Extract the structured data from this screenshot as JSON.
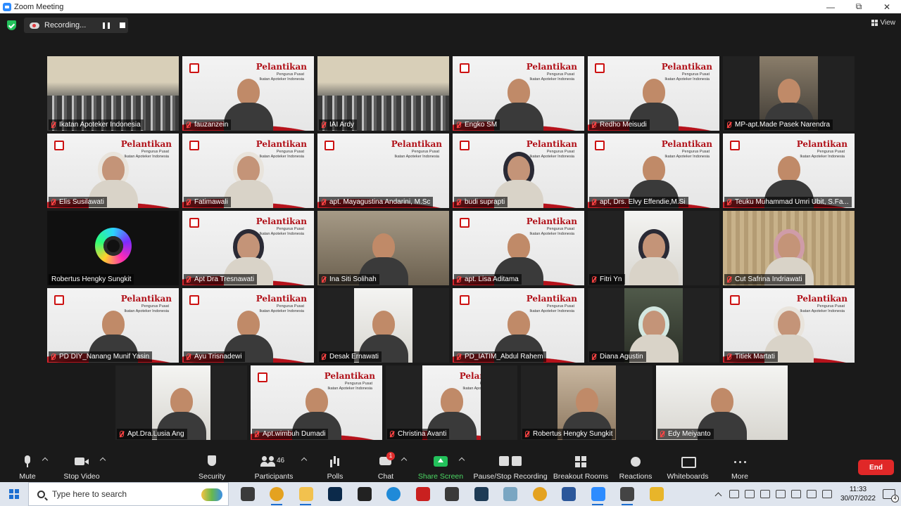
{
  "window": {
    "title": "Zoom Meeting"
  },
  "recording": {
    "label": "Recording..."
  },
  "view": {
    "label": "View"
  },
  "banner": {
    "title": "Pelantikan",
    "subtitle": "Pengurus Pusat\nIkatan Apoteker Indonesia"
  },
  "tiles": [
    {
      "name": "Ikatan Apoteker Indonesia",
      "bg": "hall"
    },
    {
      "name": "fauzanzein",
      "bg": "banner"
    },
    {
      "name": "IAI Ardy",
      "bg": "hall",
      "active": true
    },
    {
      "name": "Engko SM",
      "bg": "banner"
    },
    {
      "name": "Redho Meisudi",
      "bg": "banner"
    },
    {
      "name": "MP-apt.Made Pasek Narendra",
      "bg": "room2",
      "letterbox": true
    },
    {
      "name": "Elis Susilawati",
      "bg": "banner",
      "hijab": "light"
    },
    {
      "name": "Fatimawali",
      "bg": "banner",
      "hijab": "light"
    },
    {
      "name": "apt. Mayagustina Andarini, M.Sc",
      "bg": "banner",
      "empty": true
    },
    {
      "name": "budi suprapti",
      "bg": "banner",
      "hijab": "dark"
    },
    {
      "name": "apt, Drs. Elvy Effendie,M.Si",
      "bg": "banner"
    },
    {
      "name": "Teuku Muhammad Umri Ubit, S.Fa...",
      "bg": "banner"
    },
    {
      "name": "Robertus Hengky Sungkit",
      "bg": "dark",
      "camlogo": true
    },
    {
      "name": "Apt Dra Tresnawati",
      "bg": "banner",
      "hijab": "dark"
    },
    {
      "name": "Ina Siti Solihah",
      "bg": "room"
    },
    {
      "name": "apt. Lisa Aditama",
      "bg": "banner"
    },
    {
      "name": "Fitri Yn",
      "bg": "white",
      "letterbox": true,
      "hijab": "dark"
    },
    {
      "name": "Cut Safrina Indriawati",
      "bg": "curtain",
      "hijab": "pink"
    },
    {
      "name": "PD DIY_Nanang Munif Yasin",
      "bg": "banner"
    },
    {
      "name": "Ayu Trisnadewi",
      "bg": "banner"
    },
    {
      "name": "Desak Ernawati",
      "bg": "white",
      "letterbox": true
    },
    {
      "name": "PD_IATIM_Abdul Rahem",
      "bg": "banner"
    },
    {
      "name": "Diana Agustin",
      "bg": "car",
      "letterbox": true,
      "hijab": "mint"
    },
    {
      "name": "Titiek Martati",
      "bg": "banner",
      "hijab": "light"
    },
    {
      "name": "Apt.Dra.Lusia Ang",
      "bg": "white",
      "letterbox": true
    },
    {
      "name": "Apt.wimbuh Dumadi",
      "bg": "banner"
    },
    {
      "name": "Christina Avanti",
      "bg": "banner",
      "letterbox": true
    },
    {
      "name": "Robertus Hengky Sungkit",
      "bg": "shelf",
      "letterbox": true
    },
    {
      "name": "Edy Meiyanto",
      "bg": "white"
    }
  ],
  "toolbar": {
    "mute": "Mute",
    "stop_video": "Stop Video",
    "security": "Security",
    "participants": "Participants",
    "participants_count": "46",
    "polls": "Polls",
    "chat": "Chat",
    "chat_badge": "1",
    "share_screen": "Share Screen",
    "pause_stop_recording": "Pause/Stop Recording",
    "breakout_rooms": "Breakout Rooms",
    "reactions": "Reactions",
    "whiteboards": "Whiteboards",
    "more": "More",
    "end": "End"
  },
  "taskbar": {
    "search_placeholder": "Type here to search",
    "time": "11:33",
    "date": "30/07/2022",
    "notification_count": "4",
    "apps": [
      {
        "icon": "task-view-icon",
        "color": "#3b3b3b"
      },
      {
        "icon": "chrome-icon",
        "color": "#e4a220"
      },
      {
        "icon": "file-explorer-icon",
        "color": "#f2c14e"
      },
      {
        "icon": "photoshop-icon",
        "color": "#0b2a4a"
      },
      {
        "icon": "app-dark-icon",
        "color": "#222222"
      },
      {
        "icon": "edge-icon",
        "color": "#1f8ad8"
      },
      {
        "icon": "acrobat-icon",
        "color": "#c9201f"
      },
      {
        "icon": "headset-icon",
        "color": "#3a3a3a"
      },
      {
        "icon": "terminal-icon",
        "color": "#1e3b55"
      },
      {
        "icon": "pen-app-icon",
        "color": "#7aa6c2"
      },
      {
        "icon": "chrome-icon",
        "color": "#e4a220"
      },
      {
        "icon": "word-icon",
        "color": "#2b579a"
      },
      {
        "icon": "zoom-icon",
        "color": "#2d8cff"
      },
      {
        "icon": "clapper-icon",
        "color": "#444444"
      },
      {
        "icon": "sketch-icon",
        "color": "#e8b52a"
      }
    ]
  }
}
